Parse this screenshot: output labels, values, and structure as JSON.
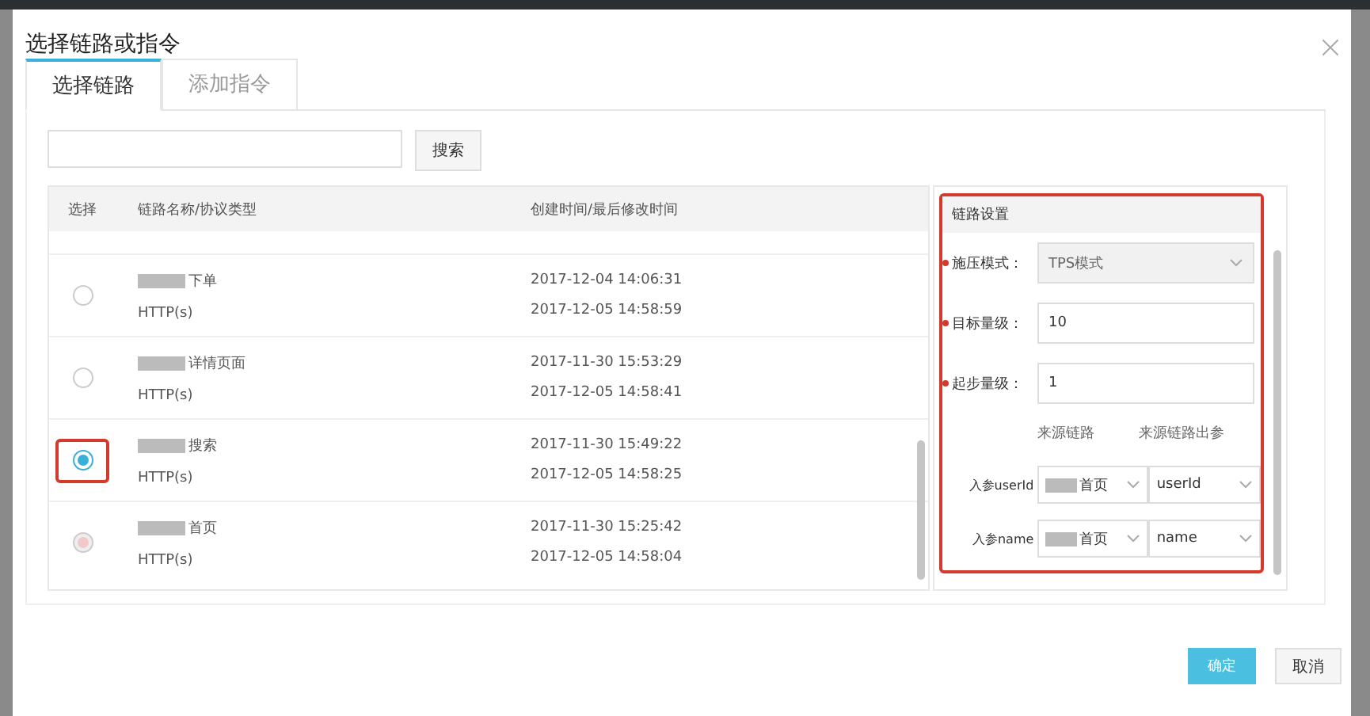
{
  "dialog": {
    "title": "选择链路或指令"
  },
  "tabs": [
    {
      "label": "选择链路",
      "selected": true
    },
    {
      "label": "添加指令",
      "selected": false
    }
  ],
  "search": {
    "button": "搜索"
  },
  "table": {
    "columns": [
      "选择",
      "链路名称/协议类型",
      "创建时间/最后修改时间"
    ],
    "rows": [
      {
        "name": "下单",
        "protocol": "HTTP(s)",
        "created": "2017-12-04 14:06:31",
        "modified": "2017-12-05 14:58:59",
        "selected": false,
        "disabled": false,
        "highlighted": false
      },
      {
        "name": "详情页面",
        "protocol": "HTTP(s)",
        "created": "2017-11-30 15:53:29",
        "modified": "2017-12-05 14:58:41",
        "selected": false,
        "disabled": false,
        "highlighted": false
      },
      {
        "name": "搜索",
        "protocol": "HTTP(s)",
        "created": "2017-11-30 15:49:22",
        "modified": "2017-12-05 14:58:25",
        "selected": true,
        "disabled": false,
        "highlighted": true
      },
      {
        "name": "首页",
        "protocol": "HTTP(s)",
        "created": "2017-11-30 15:25:42",
        "modified": "2017-12-05 14:58:04",
        "selected": false,
        "disabled": true,
        "highlighted": false
      }
    ]
  },
  "settings": {
    "title": "链路设置",
    "highlighted": true,
    "fields": [
      {
        "label": "施压模式：",
        "kind": "select",
        "value": "TPS模式",
        "required": true,
        "disabled": true
      },
      {
        "label": "目标量级：",
        "kind": "input",
        "value": "10",
        "required": true,
        "disabled": false
      },
      {
        "label": "起步量级：",
        "kind": "input",
        "value": "1",
        "required": true,
        "disabled": false
      }
    ],
    "param_columns": [
      "来源链路",
      "来源链路出参"
    ],
    "params": [
      {
        "label": "入参userId",
        "source": "首页",
        "output": "userId"
      },
      {
        "label": "入参name",
        "source": "首页",
        "output": "name"
      }
    ]
  },
  "footer": {
    "confirm": "确定",
    "cancel": "取消"
  }
}
